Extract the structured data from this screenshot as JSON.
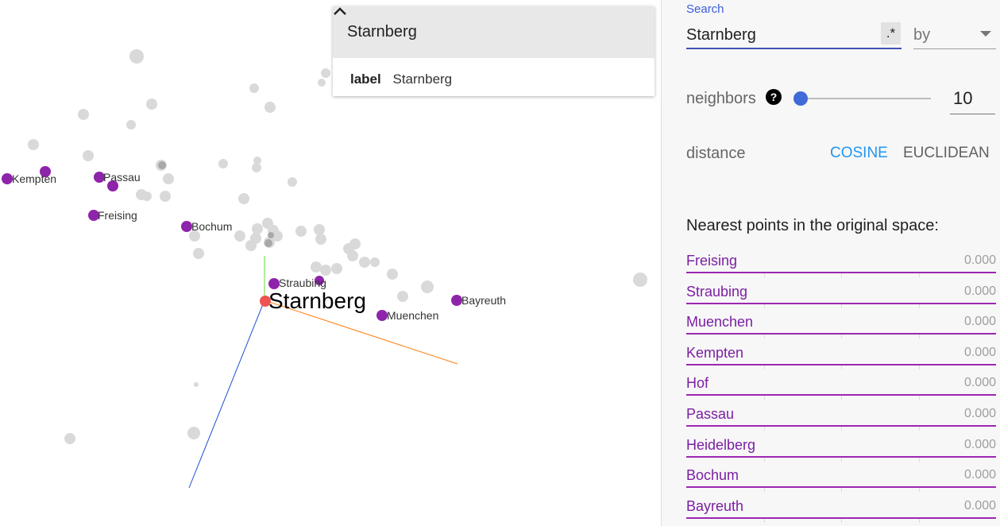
{
  "viewport": {
    "point_labels": {
      "kempten": "Kempten",
      "passau": "Passau",
      "freising": "Freising",
      "bochum": "Bochum",
      "straubing": "Straubing",
      "starnberg": "Starnberg",
      "muenchen": "Muenchen",
      "bayreuth": "Bayreuth"
    },
    "colors": {
      "neighbor": "#8e24aa",
      "selected": "#ef5350",
      "background_point": "#d9d9d9",
      "axis_x": "#ff7f0e",
      "axis_y": "#66dd33",
      "axis_z": "#1f4fd6"
    }
  },
  "point_card": {
    "title": "Starnberg",
    "collapse_icon": "chevron-up-icon",
    "fields": [
      {
        "key": "label",
        "value": "Starnberg"
      }
    ]
  },
  "panel": {
    "search": {
      "label": "Search",
      "value": "Starnberg",
      "regex_label": ".*",
      "by_label": "by"
    },
    "neighbors": {
      "label": "neighbors",
      "help_icon": "?",
      "value": "10",
      "slider_fraction": 0.0
    },
    "distance": {
      "label": "distance",
      "cosine": "COSINE",
      "euclidean": "EUCLIDEAN",
      "selected": "COSINE"
    },
    "nearest": {
      "title": "Nearest points in the original space:",
      "items": [
        {
          "name": "Freising",
          "distance": "0.000"
        },
        {
          "name": "Straubing",
          "distance": "0.000"
        },
        {
          "name": "Muenchen",
          "distance": "0.000"
        },
        {
          "name": "Kempten",
          "distance": "0.000"
        },
        {
          "name": "Hof",
          "distance": "0.000"
        },
        {
          "name": "Passau",
          "distance": "0.000"
        },
        {
          "name": "Heidelberg",
          "distance": "0.000"
        },
        {
          "name": "Bochum",
          "distance": "0.000"
        },
        {
          "name": "Bayreuth",
          "distance": "0.000"
        }
      ]
    }
  }
}
